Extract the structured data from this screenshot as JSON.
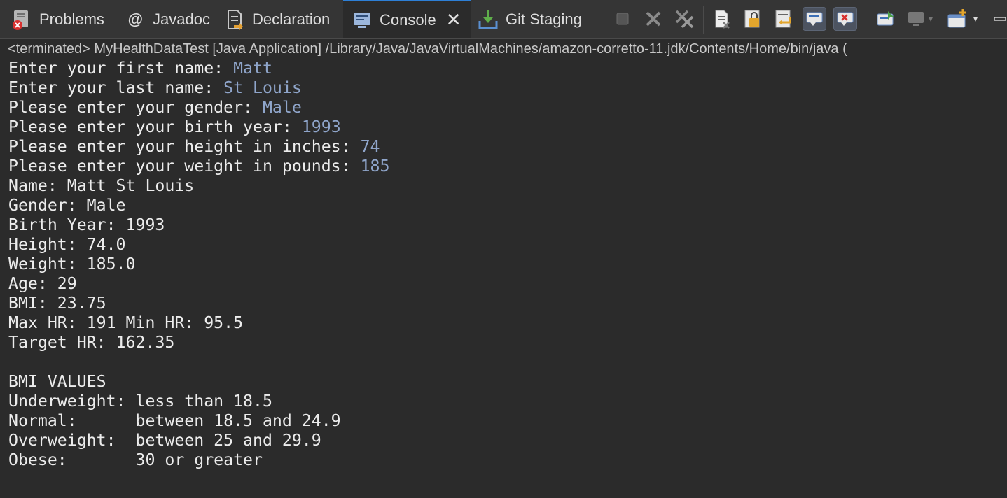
{
  "tabs": [
    {
      "label": "Problems",
      "icon": "problems-icon",
      "active": false
    },
    {
      "label": "Javadoc",
      "icon": "javadoc-at-icon",
      "active": false
    },
    {
      "label": "Declaration",
      "icon": "declaration-icon",
      "active": false
    },
    {
      "label": "Console",
      "icon": "console-icon",
      "active": true
    },
    {
      "label": "Git Staging",
      "icon": "git-staging-icon",
      "active": false
    }
  ],
  "console": {
    "status": "<terminated> MyHealthDataTest [Java Application] /Library/Java/JavaVirtualMachines/amazon-corretto-11.jdk/Contents/Home/bin/java  (",
    "lines": [
      {
        "prompt": "Enter your first name: ",
        "input": "Matt"
      },
      {
        "prompt": "Enter your last name: ",
        "input": "St Louis"
      },
      {
        "prompt": "Please enter your gender: ",
        "input": "Male"
      },
      {
        "prompt": "Please enter your birth year: ",
        "input": "1993"
      },
      {
        "prompt": "Please enter your height in inches: ",
        "input": "74"
      },
      {
        "prompt": "Please enter your weight in pounds: ",
        "input": "185"
      },
      {
        "prompt": "Name: Matt St Louis",
        "input": ""
      },
      {
        "prompt": "Gender: Male",
        "input": ""
      },
      {
        "prompt": "Birth Year: 1993",
        "input": ""
      },
      {
        "prompt": "Height: 74.0",
        "input": ""
      },
      {
        "prompt": "Weight: 185.0",
        "input": ""
      },
      {
        "prompt": "Age: 29",
        "input": ""
      },
      {
        "prompt": "BMI: 23.75",
        "input": ""
      },
      {
        "prompt": "Max HR: 191 Min HR: 95.5",
        "input": ""
      },
      {
        "prompt": "Target HR: 162.35",
        "input": ""
      },
      {
        "prompt": "",
        "input": ""
      },
      {
        "prompt": "BMI VALUES",
        "input": ""
      },
      {
        "prompt": "Underweight: less than 18.5",
        "input": ""
      },
      {
        "prompt": "Normal:      between 18.5 and 24.9",
        "input": ""
      },
      {
        "prompt": "Overweight:  between 25 and 29.9",
        "input": ""
      },
      {
        "prompt": "Obese:       30 or greater",
        "input": ""
      }
    ]
  },
  "toolbar_icons": [
    "terminate-icon",
    "remove-launch-icon",
    "remove-all-terminated-icon",
    "clear-console-icon",
    "scroll-lock-icon",
    "word-wrap-icon",
    "show-on-stdout-icon",
    "show-on-stderr-icon",
    "pin-console-icon",
    "display-console-icon",
    "open-console-icon"
  ],
  "colors": {
    "background": "#2b2b2b",
    "text": "#ececec",
    "input_text": "#8fa5ca",
    "active_tab_accent": "#2d7fd6"
  }
}
